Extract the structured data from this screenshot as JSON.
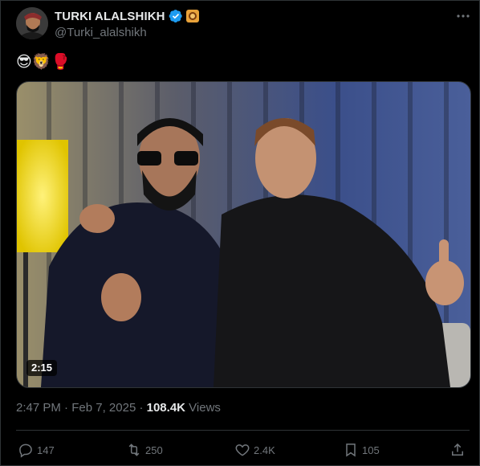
{
  "author": {
    "display_name": "TURKI ALALSHIKH",
    "handle": "@Turki_alalshikh",
    "verified_icon": "verified-badge-icon",
    "affiliation_icon": "affiliate-badge-icon",
    "verified_color": "#1d9bf0",
    "affiliation_color": "#e8a23a"
  },
  "tweet": {
    "text": "😎🦁🥊"
  },
  "media": {
    "type": "video",
    "duration": "2:15"
  },
  "meta": {
    "time": "2:47 PM",
    "separator1": " · ",
    "date": "Feb 7, 2025",
    "separator2": " · ",
    "views_count": "108.4K",
    "views_label": " Views"
  },
  "actions": {
    "replies": "147",
    "reposts": "250",
    "likes": "2.4K",
    "bookmarks": "105"
  },
  "theme": {
    "background": "#000000",
    "text": "#e7e9ea",
    "muted": "#71767b",
    "border": "#2f3336"
  }
}
